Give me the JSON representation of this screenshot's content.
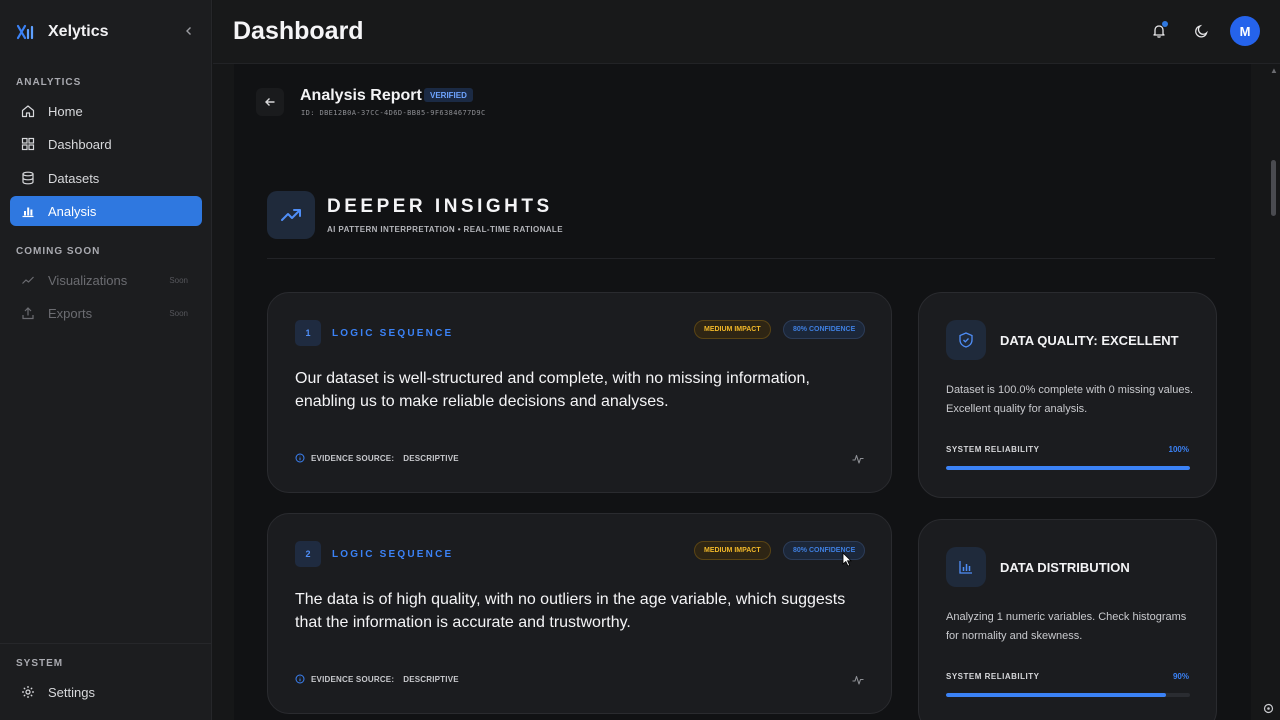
{
  "brand": {
    "name": "Xelytics"
  },
  "sidebar": {
    "analytics_label": "ANALYTICS",
    "items": [
      {
        "label": "Home",
        "icon": "home-icon"
      },
      {
        "label": "Dashboard",
        "icon": "grid-icon"
      },
      {
        "label": "Datasets",
        "icon": "database-icon"
      },
      {
        "label": "Analysis",
        "icon": "bar-chart-icon",
        "active": true
      }
    ],
    "coming_soon_label": "COMING SOON",
    "soon_items": [
      {
        "label": "Visualizations",
        "badge": "Soon",
        "icon": "trend-icon"
      },
      {
        "label": "Exports",
        "badge": "Soon",
        "icon": "upload-icon"
      }
    ],
    "system_label": "SYSTEM",
    "settings_label": "Settings"
  },
  "header": {
    "title": "Dashboard",
    "avatar_initial": "M"
  },
  "report": {
    "title": "Analysis Report",
    "status_badge": "VERIFIED",
    "id": "ID: DBE12B0A-37CC-4D6D-BB85-9F6384677D9C"
  },
  "insights": {
    "title": "DEEPER INSIGHTS",
    "subtitle": "AI PATTERN INTERPRETATION • REAL-TIME RATIONALE"
  },
  "cards": [
    {
      "number": "1",
      "label": "LOGIC SEQUENCE",
      "impact": "MEDIUM IMPACT",
      "confidence": "80% CONFIDENCE",
      "text": "Our dataset is well-structured and complete, with no missing information, enabling us to make reliable decisions and analyses.",
      "evidence_label": "EVIDENCE SOURCE:",
      "evidence_value": "DESCRIPTIVE"
    },
    {
      "number": "2",
      "label": "LOGIC SEQUENCE",
      "impact": "MEDIUM IMPACT",
      "confidence": "80% CONFIDENCE",
      "text": "The data is of high quality, with no outliers in the age variable, which suggests that the information is accurate and trustworthy.",
      "evidence_label": "EVIDENCE SOURCE:",
      "evidence_value": "DESCRIPTIVE"
    }
  ],
  "side_cards": [
    {
      "title": "DATA QUALITY: EXCELLENT",
      "text": "Dataset is 100.0% complete with 0 missing values. Excellent quality for analysis.",
      "reliability_label": "SYSTEM RELIABILITY",
      "reliability_value": "100%",
      "reliability_fraction": 1.0,
      "icon": "shield-icon"
    },
    {
      "title": "DATA DISTRIBUTION",
      "text": "Analyzing 1 numeric variables. Check histograms for normality and skewness.",
      "reliability_label": "SYSTEM RELIABILITY",
      "reliability_value": "90%",
      "reliability_fraction": 0.9,
      "icon": "bar-chart-icon"
    }
  ],
  "colors": {
    "accent": "#3b82f6",
    "impact": "#f2b829",
    "background": "#111214"
  }
}
